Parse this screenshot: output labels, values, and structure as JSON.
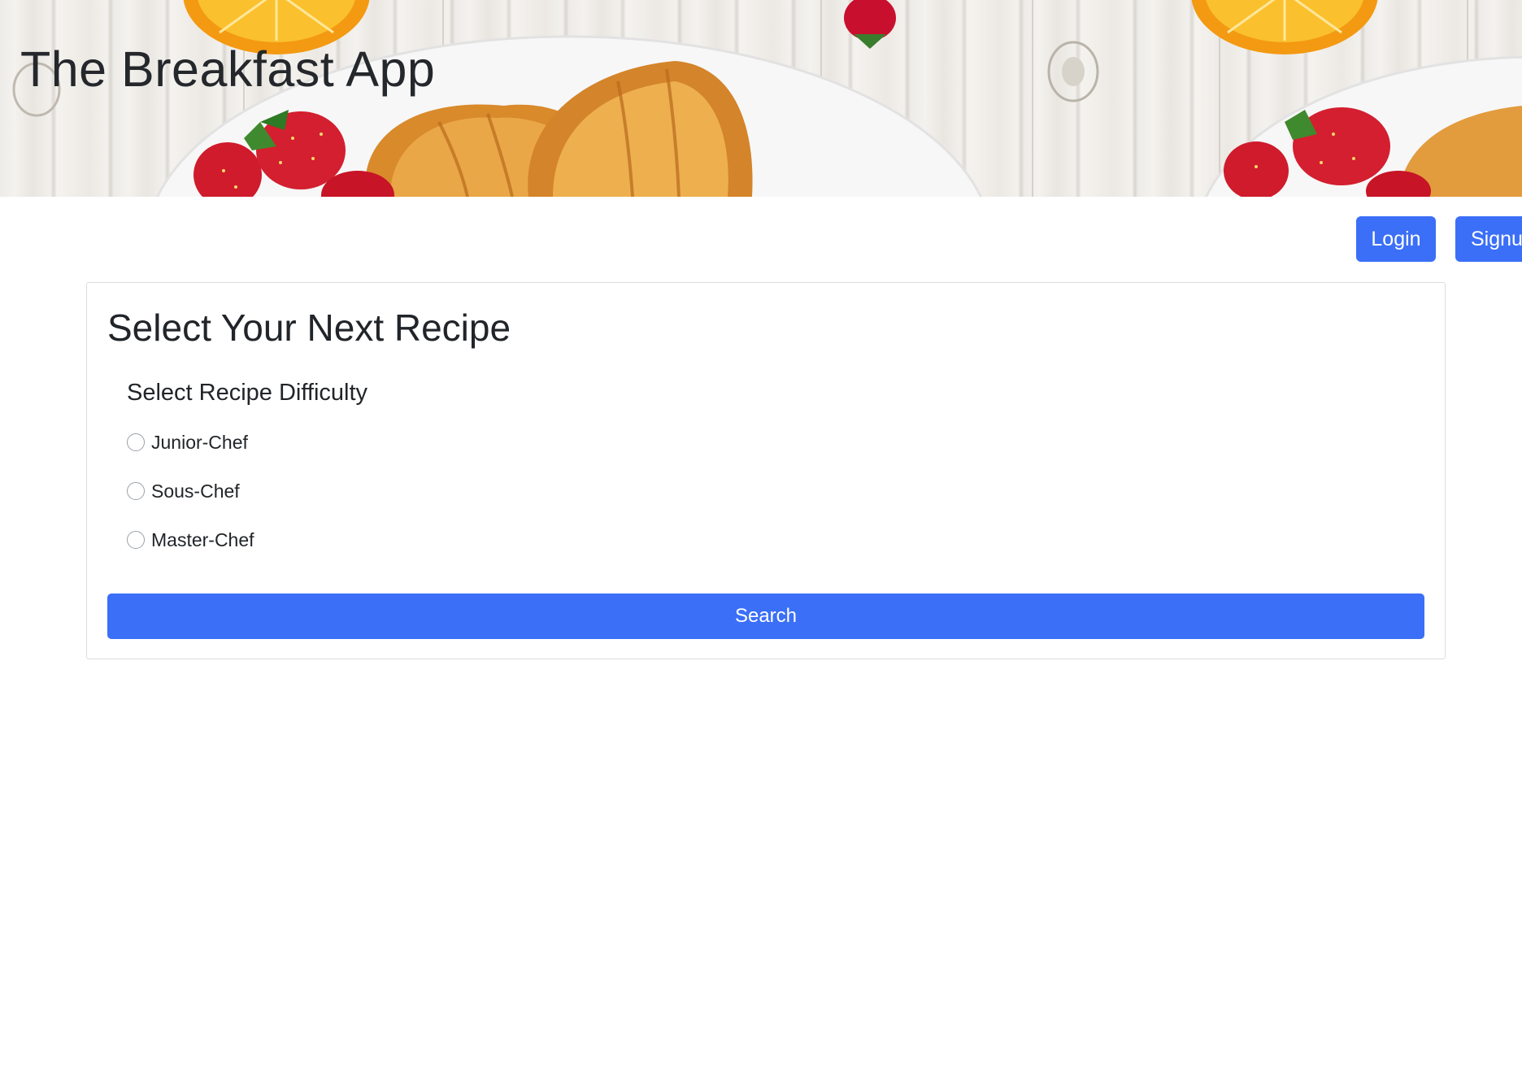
{
  "header": {
    "title": "The Breakfast App"
  },
  "auth": {
    "login_label": "Login",
    "signup_label": "Signup"
  },
  "main": {
    "heading": "Select Your Next Recipe",
    "difficulty": {
      "title": "Select Recipe Difficulty",
      "options": [
        "Junior-Chef",
        "Sous-Chef",
        "Master-Chef"
      ]
    },
    "search_label": "Search"
  },
  "colors": {
    "primary_button": "#3b6ff7",
    "text": "#212529",
    "card_border": "#dadde1"
  }
}
